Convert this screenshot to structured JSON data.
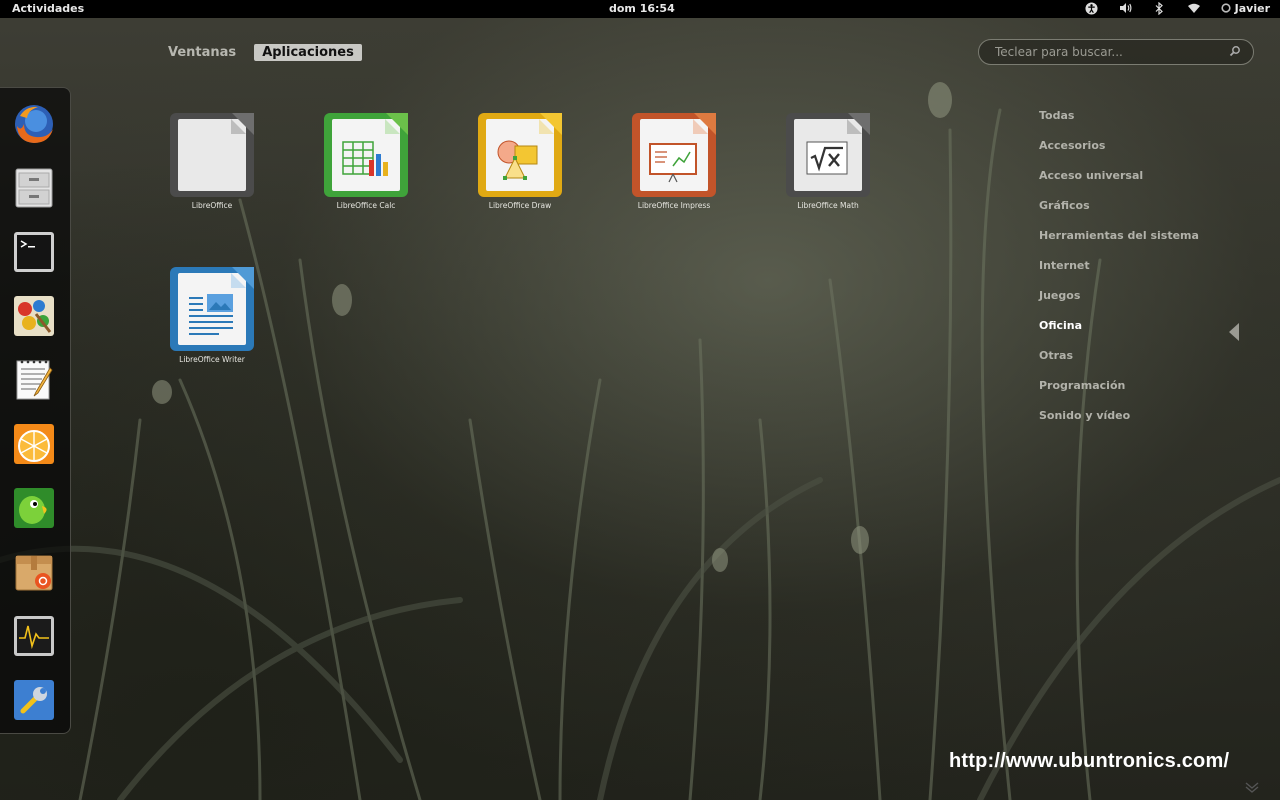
{
  "topbar": {
    "activities": "Actividades",
    "clock": "dom 16:54",
    "user": "Javier",
    "icons": [
      "accessibility-icon",
      "volume-icon",
      "bluetooth-icon",
      "wifi-icon",
      "user-status-icon"
    ]
  },
  "view_selector": {
    "tabs": [
      {
        "label": "Ventanas",
        "active": false
      },
      {
        "label": "Aplicaciones",
        "active": true
      }
    ]
  },
  "search": {
    "placeholder": "Teclear para buscar...",
    "value": ""
  },
  "dash": {
    "items": [
      {
        "name": "firefox",
        "icon": "firefox-icon"
      },
      {
        "name": "file-manager",
        "icon": "filing-cabinet-icon"
      },
      {
        "name": "terminal",
        "icon": "terminal-icon"
      },
      {
        "name": "paint",
        "icon": "palette-icon"
      },
      {
        "name": "text-editor",
        "icon": "notepad-pencil-icon"
      },
      {
        "name": "media",
        "icon": "orange-slice-icon"
      },
      {
        "name": "chat",
        "icon": "parrot-icon"
      },
      {
        "name": "software-center",
        "icon": "package-icon"
      },
      {
        "name": "system-monitor",
        "icon": "monitor-chart-icon"
      },
      {
        "name": "settings",
        "icon": "wrench-icon"
      }
    ]
  },
  "apps": [
    {
      "label": "LibreOffice",
      "icon": "libreoffice-icon",
      "color": "#5a5a5a"
    },
    {
      "label": "LibreOffice Calc",
      "icon": "libreoffice-calc-icon",
      "color": "#3fa33a"
    },
    {
      "label": "LibreOffice Draw",
      "icon": "libreoffice-draw-icon",
      "color": "#e0a913"
    },
    {
      "label": "LibreOffice Impress",
      "icon": "libreoffice-impress-icon",
      "color": "#c2542a"
    },
    {
      "label": "LibreOffice Math",
      "icon": "libreoffice-math-icon",
      "color": "#5a5a5a"
    },
    {
      "label": "LibreOffice Writer",
      "icon": "libreoffice-writer-icon",
      "color": "#2b79b8"
    }
  ],
  "categories": [
    {
      "label": "Todas",
      "active": false
    },
    {
      "label": "Accesorios",
      "active": false
    },
    {
      "label": "Acceso universal",
      "active": false
    },
    {
      "label": "Gráficos",
      "active": false
    },
    {
      "label": "Herramientas del sistema",
      "active": false
    },
    {
      "label": "Internet",
      "active": false
    },
    {
      "label": "Juegos",
      "active": false
    },
    {
      "label": "Oficina",
      "active": true
    },
    {
      "label": "Otras",
      "active": false
    },
    {
      "label": "Programación",
      "active": false
    },
    {
      "label": "Sonido y vídeo",
      "active": false
    }
  ],
  "watermark": "http://www.ubuntronics.com/"
}
